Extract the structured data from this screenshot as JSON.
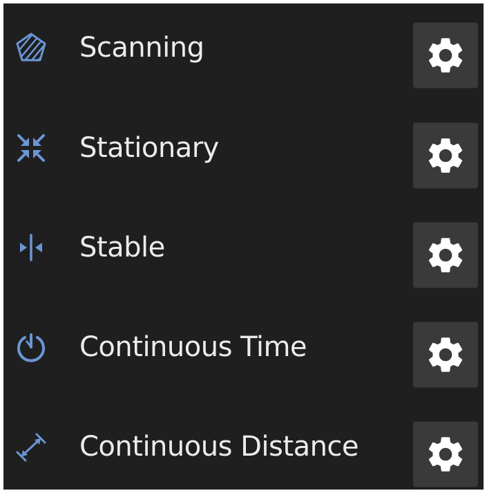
{
  "colors": {
    "panel_background": "#1f1f1f",
    "label_text": "#ececec",
    "icon_accent": "#6b96d6",
    "button_background": "#3a3a3a",
    "gear": "#ffffff"
  },
  "modes": [
    {
      "label": "Scanning",
      "icon": "pentagon-hatched-icon"
    },
    {
      "label": "Stationary",
      "icon": "arrows-inward-icon"
    },
    {
      "label": "Stable",
      "icon": "arrows-to-line-icon"
    },
    {
      "label": "Continuous Time",
      "icon": "timer-icon"
    },
    {
      "label": "Continuous Distance",
      "icon": "diagonal-distance-icon"
    }
  ],
  "settings_button": {
    "icon": "gear-icon"
  }
}
